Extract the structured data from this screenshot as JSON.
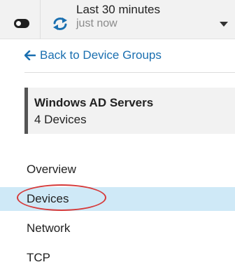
{
  "time_selector": {
    "range_label": "Last 30 minutes",
    "refresh_label": "just now"
  },
  "back_link": {
    "label": "Back to Device Groups"
  },
  "group": {
    "name": "Windows AD Servers",
    "device_count": "4 Devices"
  },
  "nav": {
    "items": [
      {
        "label": "Overview",
        "active": false
      },
      {
        "label": "Devices",
        "active": true
      },
      {
        "label": "Network",
        "active": false
      },
      {
        "label": "TCP",
        "active": false
      }
    ]
  },
  "colors": {
    "link": "#1a6fb0",
    "active_bg": "#cfe9f7",
    "annotation_ring": "#d63a3a"
  },
  "icons": {
    "toggle": "toggle-icon",
    "refresh": "refresh-icon",
    "dropdown": "chevron-down-icon",
    "back": "arrow-left-icon"
  }
}
